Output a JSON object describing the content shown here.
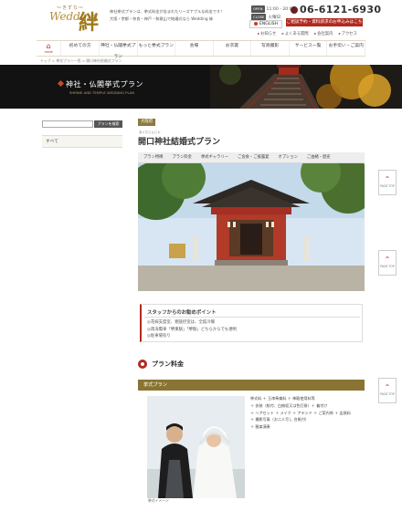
{
  "header": {
    "logo_sub": "〜きずな〜",
    "logo_script": "Wedding",
    "logo_kanji": "絆",
    "tagline_1": "神社挙式プランは、挙式料金が含まれたリーズナブルな料金です！",
    "tagline_2": "大阪・京都・奈良・神戸・和歌山で結婚式なら Wedding 絆",
    "hours_tag": "OPEN",
    "hours": "11:00 - 20:00",
    "closed_tag": "CLOSE",
    "closed": "火曜日",
    "english": "ENGLISH",
    "phone": "06-6121-6930",
    "request": "ご相談予約・資料請求のお申込みはこちら",
    "utility": [
      "お知らせ",
      "よくある質問",
      "会社案内",
      "アクセス"
    ]
  },
  "nav": {
    "home_label": "HOME",
    "items": [
      "初めての方",
      "神社・仏閣挙式プラン",
      "もっと挙式プラン",
      "会場",
      "お衣裳",
      "写真撮影",
      "サービス一覧",
      "お手伝い・ご案内"
    ]
  },
  "breadcrumb": "トップ > 挙式プラン一覧 > 開口神社結婚式プラン",
  "hero": {
    "title": "神社・仏閣挙式プラン",
    "subtitle": "SHRINE AND TEMPLE WEDDING PLAN"
  },
  "sidebar": {
    "search_button": "プランを検索",
    "item": "すべて"
  },
  "main": {
    "category_tag": "大阪府",
    "ruby": "あぐちじんじゃ",
    "title": "開口神社結婚式プラン",
    "tabs": [
      "プラン特徴",
      "プラン料金",
      "挙式ギャラリー",
      "ご会食・ご披露宴",
      "オプション",
      "ご由緒・歴史"
    ],
    "points_heading": "スタッフからのお勧めポイント",
    "points": [
      "花嫁支度室、親族控室は、全館冷暖",
      "南海電車「堺東駅」「堺駅」どちらからでも便利",
      "駐車場有り"
    ],
    "plan_heading": "プラン料金",
    "plan_bar": "挙式プラン",
    "plan_caption": "挙式イメージ",
    "plan_list": [
      "挙式料 ＋ 玉串奉奠料 ＋ 神殿使用料等",
      "＋ 衣装（紋付、白無垢又は色打掛）＋ 着付け",
      "＋ ヘアセット ＋ メイク ＋ アテンド ＋ ご案内係 ＋ 出張料",
      "＋ 撮影写真（お二人写し 台紙付）",
      "＋ 雅楽演奏"
    ]
  },
  "page_top": "PAGE TOP",
  "colors": {
    "accent": "#b12a1f",
    "gold": "#8a7434"
  }
}
